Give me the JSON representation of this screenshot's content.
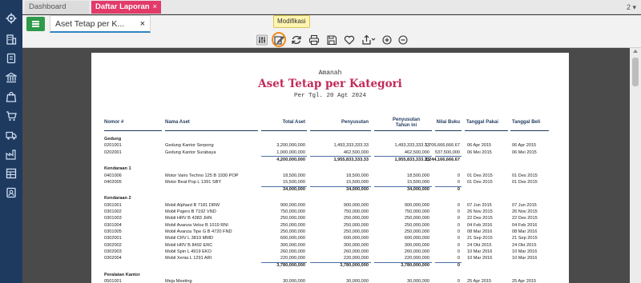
{
  "tabs": {
    "dashboard": "Dashboard",
    "laporan": "Daftar Laporan",
    "count": "2"
  },
  "doc_tab": {
    "label": "Aset Tetap per K..."
  },
  "tooltip": "Modifikasi",
  "toolbar": {
    "items": [
      "filter-icon",
      "edit-icon",
      "refresh-icon",
      "print-icon",
      "save-icon",
      "favorite-icon",
      "export-icon",
      "zoom-in-icon",
      "zoom-out-icon"
    ]
  },
  "report": {
    "company": "Amanah",
    "title": "Aset Tetap per Kategori",
    "date": "Per Tgl. 20 Agt 2024",
    "headers": {
      "nomor": "Nomor #",
      "nama": "Nama Aset",
      "total": "Total Aset",
      "penyusutan": "Penyusutan",
      "penyusutan_tahun1": "Penyusutan",
      "penyusutan_tahun2": "Tahun ini",
      "nilai": "Nilai Buku",
      "pakai": "Tanggal Pakai",
      "beli": "Tanggal Beli"
    },
    "groups": [
      {
        "name": "Gedung",
        "rows": [
          {
            "no": "0201001",
            "nama": "Gedung Kantor Serpong",
            "total": "3,200,000,000",
            "peny": "1,493,333,333.33",
            "penyt": "1,493,333,333.33",
            "nilai": "1,706,666,666.67",
            "pakai": "06 Apr 2015",
            "beli": "06 Apr 2015"
          },
          {
            "no": "0202001",
            "nama": "Gedung Kantor Surabaya",
            "total": "1,000,000,000",
            "peny": "462,500,000",
            "penyt": "462,500,000",
            "nilai": "537,500,000",
            "pakai": "06 Mei 2015",
            "beli": "06 Mei 2015"
          }
        ],
        "total": {
          "total": "4,200,000,000",
          "peny": "1,955,833,333.33",
          "penyt": "1,955,833,333.33",
          "nilai": "2,244,166,666.67"
        }
      },
      {
        "name": "Kendaraan 1",
        "rows": [
          {
            "no": "0401006",
            "nama": "Motor  Vario Techno 125 B 1930 POP",
            "total": "18,500,000",
            "peny": "18,500,000",
            "penyt": "18,500,000",
            "nilai": "0",
            "pakai": "01 Des 2015",
            "beli": "01 Des 2015"
          },
          {
            "no": "0402005",
            "nama": "Motor Beat Pop L 1391 SBY",
            "total": "15,500,000",
            "peny": "15,500,000",
            "penyt": "15,500,000",
            "nilai": "0",
            "pakai": "01 Des 2015",
            "beli": "01 Des 2015"
          }
        ],
        "total": {
          "total": "34,000,000",
          "peny": "34,000,000",
          "penyt": "34,000,000",
          "nilai": "0"
        }
      },
      {
        "name": "Kendaraan 2",
        "rows": [
          {
            "no": "0301001",
            "nama": "Mobil Alphard B 7181 DRW",
            "total": "900,000,000",
            "peny": "900,000,000",
            "penyt": "900,000,000",
            "nilai": "0",
            "pakai": "07 Jun 2015",
            "beli": "07 Jun 2015"
          },
          {
            "no": "0301002",
            "nama": "Mobil Pajero B 7192 VND",
            "total": "750,000,000",
            "peny": "750,000,000",
            "penyt": "750,000,000",
            "nilai": "0",
            "pakai": "26 Nov 2015",
            "beli": "26 Nov 2015"
          },
          {
            "no": "0301003",
            "nama": "Mobil HRV B 4383 JHN",
            "total": "250,000,000",
            "peny": "250,000,000",
            "penyt": "250,000,000",
            "nilai": "0",
            "pakai": "22 Des 2015",
            "beli": "22 Des 2015"
          },
          {
            "no": "0301004",
            "nama": "Mobil Avanza Veloz B 1019 RNI",
            "total": "250,000,000",
            "peny": "250,000,000",
            "penyt": "250,000,000",
            "nilai": "0",
            "pakai": "04 Feb 2016",
            "beli": "04 Feb 2016"
          },
          {
            "no": "0301005",
            "nama": "Mobil Avanza Tipe G B 4720 FND",
            "total": "250,000,000",
            "peny": "250,000,000",
            "penyt": "250,000,000",
            "nilai": "0",
            "pakai": "08 Mar 2016",
            "beli": "08 Mar 2016"
          },
          {
            "no": "0302001",
            "nama": "Mobil CRV L 3819 MMD",
            "total": "600,000,000",
            "peny": "600,000,000",
            "penyt": "600,000,000",
            "nilai": "0",
            "pakai": "21 Sep 2015",
            "beli": "21 Sep 2015"
          },
          {
            "no": "0302002",
            "nama": "Mobil HRV B 8492 ERC",
            "total": "300,000,000",
            "peny": "300,000,000",
            "penyt": "300,000,000",
            "nilai": "0",
            "pakai": "24 Okt 2015",
            "beli": "24 Okt 2015"
          },
          {
            "no": "0302003",
            "nama": "Mobil Spin L 4919 EKO",
            "total": "260,000,000",
            "peny": "260,000,000",
            "penyt": "260,000,000",
            "nilai": "0",
            "pakai": "10 Mar 2016",
            "beli": "10 Mar 2016"
          },
          {
            "no": "0302004",
            "nama": "Mobil Xenia L 1291 ARI",
            "total": "220,000,000",
            "peny": "220,000,000",
            "penyt": "220,000,000",
            "nilai": "0",
            "pakai": "10 Mar 2016",
            "beli": "10 Mar 2016"
          }
        ],
        "total": {
          "total": "3,780,000,000",
          "peny": "3,780,000,000",
          "penyt": "3,780,000,000",
          "nilai": "0"
        }
      },
      {
        "name": "Peralatan Kantor",
        "rows": [
          {
            "no": "0501001",
            "nama": "Meja Meeting",
            "total": "30,000,000",
            "peny": "30,000,000",
            "penyt": "30,000,000",
            "nilai": "0",
            "pakai": "25 Apr 2015",
            "beli": "25 Apr 2015"
          }
        ]
      }
    ]
  }
}
